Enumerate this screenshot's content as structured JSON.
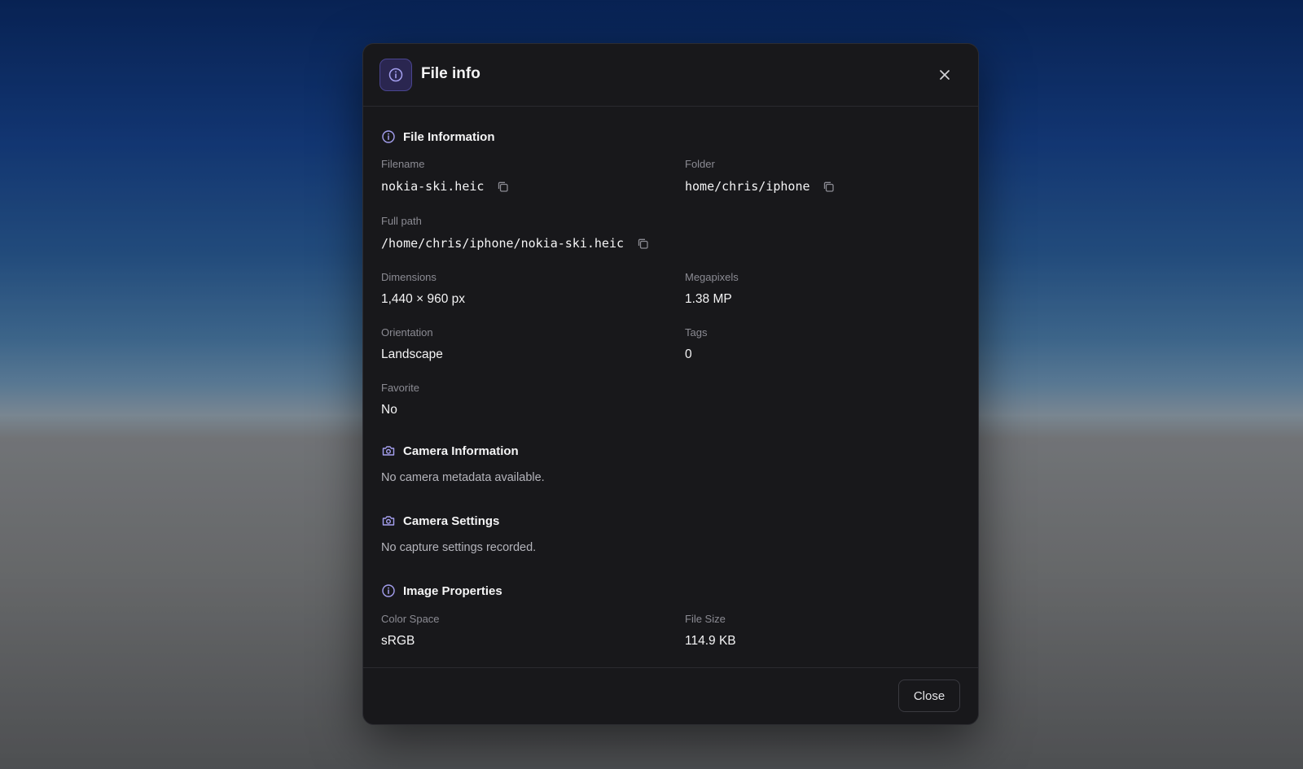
{
  "dialog": {
    "title": "File info",
    "close_label": "Close"
  },
  "sections": {
    "file_info": {
      "title": "File Information",
      "filename_label": "Filename",
      "filename_value": "nokia-ski.heic",
      "folder_label": "Folder",
      "folder_value": "home/chris/iphone",
      "fullpath_label": "Full path",
      "fullpath_value": "/home/chris/iphone/nokia-ski.heic",
      "dimensions_label": "Dimensions",
      "dimensions_value": "1,440 × 960 px",
      "megapixels_label": "Megapixels",
      "megapixels_value": "1.38 MP",
      "orientation_label": "Orientation",
      "orientation_value": "Landscape",
      "tags_label": "Tags",
      "tags_value": "0",
      "favorite_label": "Favorite",
      "favorite_value": "No"
    },
    "camera_info": {
      "title": "Camera Information",
      "empty_text": "No camera metadata available."
    },
    "camera_settings": {
      "title": "Camera Settings",
      "empty_text": "No capture settings recorded."
    },
    "image_props": {
      "title": "Image Properties",
      "colorspace_label": "Color Space",
      "colorspace_value": "sRGB",
      "filesize_label": "File Size",
      "filesize_value": "114.9 KB"
    }
  },
  "icons": {
    "header": "info-icon",
    "close": "close-icon",
    "copy": "copy-icon",
    "camera": "camera-icon"
  },
  "colors": {
    "dialog_bg": "#18181b",
    "accent": "#a5a0f0",
    "muted_text": "#8b8b93"
  }
}
